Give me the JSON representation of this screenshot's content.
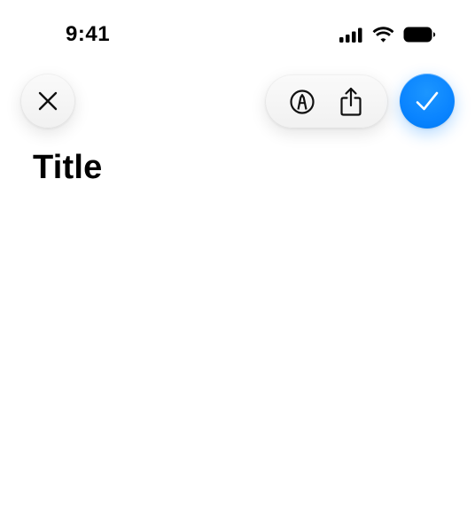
{
  "status_bar": {
    "time": "9:41"
  },
  "toolbar": {
    "close_icon": "close-icon",
    "markup_icon": "markup-pen-icon",
    "share_icon": "share-icon",
    "done_icon": "checkmark-icon",
    "done_color": "#0a84ff"
  },
  "page": {
    "title": "Title"
  }
}
